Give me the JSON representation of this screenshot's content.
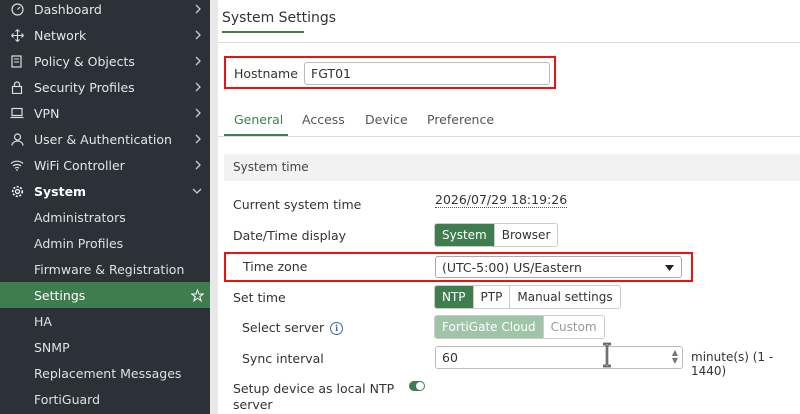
{
  "sidebar": {
    "items": [
      {
        "label": "Dashboard",
        "icon": "dashboard-icon"
      },
      {
        "label": "Network",
        "icon": "network-icon"
      },
      {
        "label": "Policy & Objects",
        "icon": "policy-icon"
      },
      {
        "label": "Security Profiles",
        "icon": "security-icon"
      },
      {
        "label": "VPN",
        "icon": "vpn-icon"
      },
      {
        "label": "User & Authentication",
        "icon": "user-icon"
      },
      {
        "label": "WiFi Controller",
        "icon": "wifi-icon"
      },
      {
        "label": "System",
        "icon": "gear-icon"
      }
    ],
    "sub_items": [
      "Administrators",
      "Admin Profiles",
      "Firmware & Registration",
      "Settings",
      "HA",
      "SNMP",
      "Replacement Messages",
      "FortiGuard"
    ]
  },
  "page": {
    "title": "System Settings"
  },
  "hostname": {
    "label": "Hostname",
    "value": "FGT01"
  },
  "tabs": [
    "General",
    "Access",
    "Device",
    "Preference"
  ],
  "system_time": {
    "section_title": "System time",
    "current_label": "Current system time",
    "current_value": "2026/07/29 18:19:26",
    "display_label": "Date/Time display",
    "display_options": [
      "System",
      "Browser"
    ],
    "timezone_label": "Time zone",
    "timezone_value": "(UTC-5:00) US/Eastern",
    "set_time_label": "Set time",
    "set_time_options": [
      "NTP",
      "PTP",
      "Manual settings"
    ],
    "select_server_label": "Select server",
    "server_options": [
      "FortiGate Cloud",
      "Custom"
    ],
    "sync_label": "Sync interval",
    "sync_value": "60",
    "sync_suffix": "minute(s) (1 - 1440)",
    "local_ntp_label_1": "Setup device as local NTP",
    "local_ntp_label_2": "server"
  },
  "colors": {
    "accent": "#3f7d4e",
    "highlight": "#ee1111",
    "sidebar": "#2c3138"
  }
}
